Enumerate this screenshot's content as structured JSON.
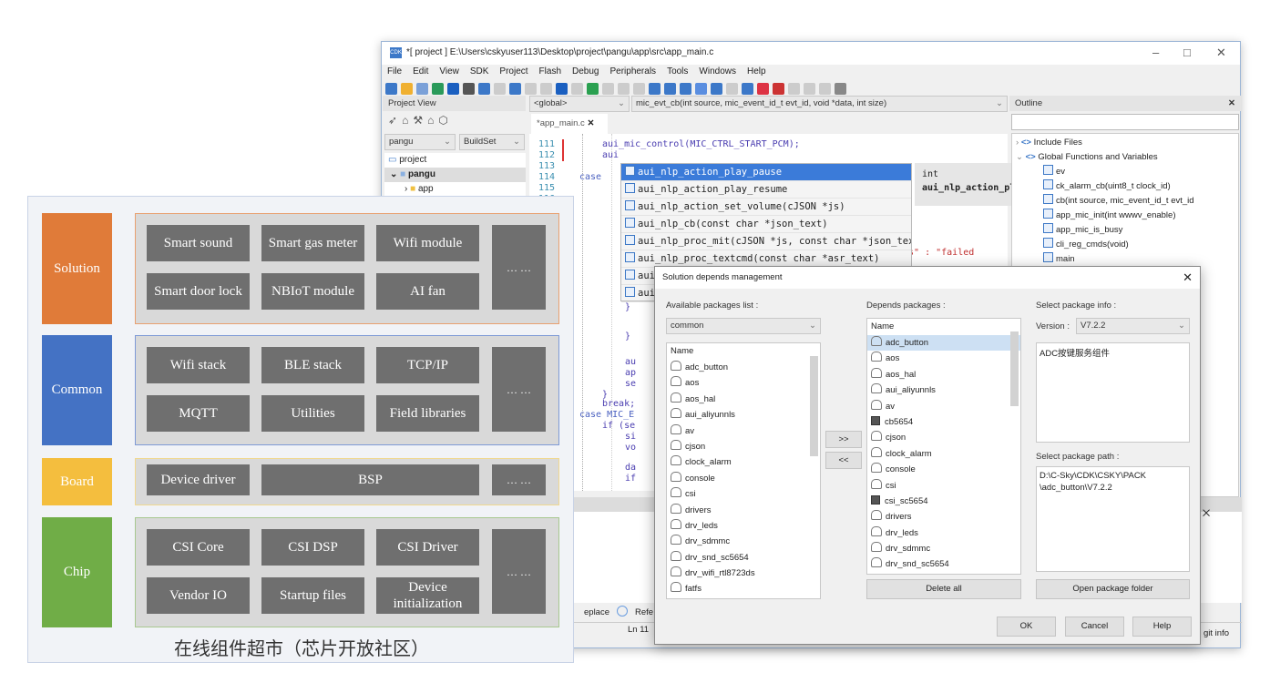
{
  "ide": {
    "title": "*[ project ] E:\\Users\\cskyuser113\\Desktop\\project\\pangu\\app\\src\\app_main.c",
    "app_icon": "CDK",
    "menu": [
      "File",
      "Edit",
      "View",
      "SDK",
      "Project",
      "Flash",
      "Debug",
      "Peripherals",
      "Tools",
      "Windows",
      "Help"
    ],
    "project_view": {
      "title": "Project View",
      "project_combo": "pangu",
      "buildset_combo": "BuildSet",
      "tree": [
        {
          "label": "project"
        },
        {
          "label": "pangu"
        },
        {
          "label": "app"
        }
      ]
    },
    "scope_combo": "<global>",
    "function_combo": "mic_evt_cb(int source, mic_event_id_t evt_id, void *data, int size)",
    "tab": "*app_main.c",
    "line_numbers": [
      "111",
      "112",
      "113",
      "114",
      "115",
      "116"
    ],
    "code_lines": [
      "aui_mic_control(MIC_CTRL_START_PCM);",
      "aui",
      "case",
      "ss\" : \"failed",
      "}",
      "}",
      "au",
      "ap",
      "se",
      "}",
      "break;",
      "case MIC_E",
      "if (se",
      "si",
      "vo",
      "da",
      "if"
    ],
    "autocomplete": [
      "aui_nlp_action_play_pause",
      "aui_nlp_action_play_resume",
      "aui_nlp_action_set_volume(cJSON *js)",
      "aui_nlp_cb(const char *json_text)",
      "aui_nlp_proc_mit(cJSON *js, const char *json_text",
      "aui_nlp_proc_textcmd(const char *asr_text)",
      "aui_",
      "aui_"
    ],
    "tooltip": {
      "type": "int",
      "signature_bold": "aui_nlp_action_play_pause",
      "signature_rest": "();"
    },
    "outline": {
      "title": "Outline",
      "items": [
        "Include Files",
        "Global Functions and Variables",
        "ev",
        "ck_alarm_cb(uint8_t clock_id)",
        "cb(int source, mic_event_id_t evt_id",
        "app_mic_init(int wwwv_enable)",
        "app_mic_is_busy",
        "cli_reg_cmds(void)",
        "main"
      ]
    },
    "bottom": {
      "replace": "eplace",
      "refer": "Refe",
      "line": "Ln 11",
      "git": "git info"
    }
  },
  "dialog": {
    "title": "Solution depends management",
    "available_label": "Available packages list :",
    "category_combo": "common",
    "column_name": "Name",
    "available": [
      "adc_button",
      "aos",
      "aos_hal",
      "aui_aliyunnls",
      "av",
      "cjson",
      "clock_alarm",
      "console",
      "csi",
      "drivers",
      "drv_leds",
      "drv_sdmmc",
      "drv_snd_sc5654",
      "drv_wifi_rtl8723ds",
      "fatfs"
    ],
    "add_button": ">>",
    "remove_button": "<<",
    "depends_label": "Depends packages :",
    "depends": [
      {
        "name": "adc_button",
        "icon": "package"
      },
      {
        "name": "aos",
        "icon": "package"
      },
      {
        "name": "aos_hal",
        "icon": "package"
      },
      {
        "name": "aui_aliyunnls",
        "icon": "package"
      },
      {
        "name": "av",
        "icon": "package"
      },
      {
        "name": "cb5654",
        "icon": "board"
      },
      {
        "name": "cjson",
        "icon": "package"
      },
      {
        "name": "clock_alarm",
        "icon": "package"
      },
      {
        "name": "console",
        "icon": "package"
      },
      {
        "name": "csi",
        "icon": "package"
      },
      {
        "name": "csi_sc5654",
        "icon": "chip"
      },
      {
        "name": "drivers",
        "icon": "package"
      },
      {
        "name": "drv_leds",
        "icon": "package"
      },
      {
        "name": "drv_sdmmc",
        "icon": "package"
      },
      {
        "name": "drv_snd_sc5654",
        "icon": "package"
      }
    ],
    "delete_all": "Delete all",
    "info_label": "Select package info :",
    "version_label": "Version :",
    "version": "V7.2.2",
    "description": "ADC按键服务组件",
    "path_label": "Select package path :",
    "path": "D:\\C-Sky\\CDK\\CSKY\\PACK\n\\adc_button\\V7.2.2",
    "open_folder": "Open package folder",
    "ok": "OK",
    "cancel": "Cancel",
    "help": "Help"
  },
  "diagram": {
    "layers": [
      {
        "name": "Solution",
        "color": "#e07b39",
        "border": "#e8a070",
        "rows": [
          [
            "Smart sound",
            "Smart gas meter",
            "Wifi module"
          ],
          [
            "Smart door lock",
            "NBIoT module",
            "AI fan"
          ]
        ],
        "more": "… …"
      },
      {
        "name": "Common",
        "color": "#4472c4",
        "border": "#7e9ad6",
        "rows": [
          [
            "Wifi stack",
            "BLE stack",
            "TCP/IP"
          ],
          [
            "MQTT",
            "Utilities",
            "Field libraries"
          ]
        ],
        "more": "… …"
      },
      {
        "name": "Board",
        "color": "#f4be3e",
        "border": "#f0d890",
        "rows": [
          [
            "Device driver",
            "BSP"
          ]
        ],
        "more": "… …"
      },
      {
        "name": "Chip",
        "color": "#70ad47",
        "border": "#a8c890",
        "rows": [
          [
            "CSI Core",
            "CSI DSP",
            "CSI Driver"
          ],
          [
            "Vendor IO",
            "Startup files",
            "Device initialization"
          ]
        ],
        "more": "… …"
      }
    ],
    "caption": "在线组件超市（芯片开放社区）"
  }
}
